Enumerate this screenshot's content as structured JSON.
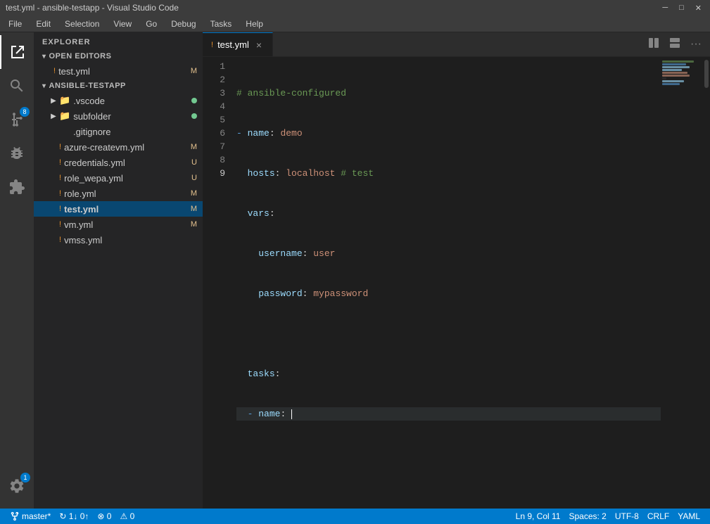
{
  "titlebar": {
    "title": "test.yml - ansible-testapp - Visual Studio Code",
    "minimize": "─",
    "maximize": "□",
    "close": "✕"
  },
  "menubar": {
    "items": [
      "File",
      "Edit",
      "Selection",
      "View",
      "Go",
      "Debug",
      "Tasks",
      "Help"
    ]
  },
  "activitybar": {
    "icons": [
      {
        "name": "explorer-icon",
        "symbol": "⎘",
        "active": true
      },
      {
        "name": "search-icon",
        "symbol": "🔍",
        "active": false
      },
      {
        "name": "source-control-icon",
        "symbol": "⑂",
        "active": false,
        "badge": "8"
      },
      {
        "name": "debug-icon",
        "symbol": "▷",
        "active": false
      },
      {
        "name": "extensions-icon",
        "symbol": "⊞",
        "active": false
      }
    ],
    "settings_badge": "1"
  },
  "sidebar": {
    "header": "Explorer",
    "open_editors": {
      "label": "Open Editors",
      "files": [
        {
          "name": "test.yml",
          "badge": "M",
          "badgeClass": "modified"
        }
      ]
    },
    "project": {
      "label": "Ansible-Testapp",
      "items": [
        {
          "name": ".vscode",
          "type": "folder",
          "indent": 1,
          "dot": "green"
        },
        {
          "name": "subfolder",
          "type": "folder",
          "indent": 1,
          "dot": "green"
        },
        {
          "name": ".gitignore",
          "type": "file",
          "indent": 1,
          "dot": ""
        },
        {
          "name": "azure-createvm.yml",
          "type": "yaml",
          "indent": 1,
          "badge": "M"
        },
        {
          "name": "credentials.yml",
          "type": "yaml",
          "indent": 1,
          "badge": "U"
        },
        {
          "name": "role_wepa.yml",
          "type": "yaml",
          "indent": 1,
          "badge": "U"
        },
        {
          "name": "role.yml",
          "type": "yaml",
          "indent": 1,
          "badge": "M"
        },
        {
          "name": "test.yml",
          "type": "yaml",
          "indent": 1,
          "badge": "M",
          "active": true
        },
        {
          "name": "vm.yml",
          "type": "yaml",
          "indent": 1,
          "badge": "M"
        },
        {
          "name": "vmss.yml",
          "type": "yaml",
          "indent": 1,
          "badge": ""
        }
      ]
    }
  },
  "editor": {
    "tab": "test.yml",
    "lines": [
      {
        "num": "1",
        "tokens": [
          {
            "text": "# ansible-configured",
            "cls": "c-comment"
          }
        ]
      },
      {
        "num": "2",
        "tokens": [
          {
            "text": "- ",
            "cls": "c-dash"
          },
          {
            "text": "name",
            "cls": "c-property"
          },
          {
            "text": ": ",
            "cls": ""
          },
          {
            "text": "demo",
            "cls": "c-string"
          }
        ]
      },
      {
        "num": "3",
        "tokens": [
          {
            "text": "  hosts",
            "cls": "c-property"
          },
          {
            "text": ": ",
            "cls": ""
          },
          {
            "text": "localhost",
            "cls": "c-string"
          },
          {
            "text": " # test",
            "cls": "c-comment"
          }
        ]
      },
      {
        "num": "4",
        "tokens": [
          {
            "text": "  vars",
            "cls": "c-property"
          },
          {
            "text": ":",
            "cls": ""
          }
        ]
      },
      {
        "num": "5",
        "tokens": [
          {
            "text": "    username",
            "cls": "c-property"
          },
          {
            "text": ": ",
            "cls": ""
          },
          {
            "text": "user",
            "cls": "c-string"
          }
        ]
      },
      {
        "num": "6",
        "tokens": [
          {
            "text": "    password",
            "cls": "c-property"
          },
          {
            "text": ": ",
            "cls": ""
          },
          {
            "text": "mypassword",
            "cls": "c-string"
          }
        ]
      },
      {
        "num": "7",
        "tokens": [
          {
            "text": "",
            "cls": ""
          }
        ]
      },
      {
        "num": "8",
        "tokens": [
          {
            "text": "  tasks",
            "cls": "c-property"
          },
          {
            "text": ":",
            "cls": ""
          }
        ]
      },
      {
        "num": "9",
        "tokens": [
          {
            "text": "  - ",
            "cls": "c-dash"
          },
          {
            "text": "name",
            "cls": "c-property"
          },
          {
            "text": ": ",
            "cls": ""
          }
        ],
        "cursor": true
      }
    ]
  },
  "statusbar": {
    "branch": "master*",
    "sync": "↻ 1↓ 0↑",
    "errors": "⊗ 0",
    "warnings": "⚠ 0",
    "ln_col": "Ln 9, Col 11",
    "spaces": "Spaces: 2",
    "encoding": "UTF-8",
    "line_ending": "CRLF",
    "language": "YAML"
  },
  "minimap": {
    "lines": [
      {
        "width": "80%",
        "color": "#6a9955"
      },
      {
        "width": "60%",
        "color": "#569cd6"
      },
      {
        "width": "70%",
        "color": "#9cdcfe"
      },
      {
        "width": "50%",
        "color": "#9cdcfe"
      },
      {
        "width": "65%",
        "color": "#ce9178"
      },
      {
        "width": "70%",
        "color": "#ce9178"
      },
      {
        "width": "20%",
        "color": "#1e1e1e"
      },
      {
        "width": "55%",
        "color": "#9cdcfe"
      },
      {
        "width": "45%",
        "color": "#569cd6"
      }
    ]
  }
}
